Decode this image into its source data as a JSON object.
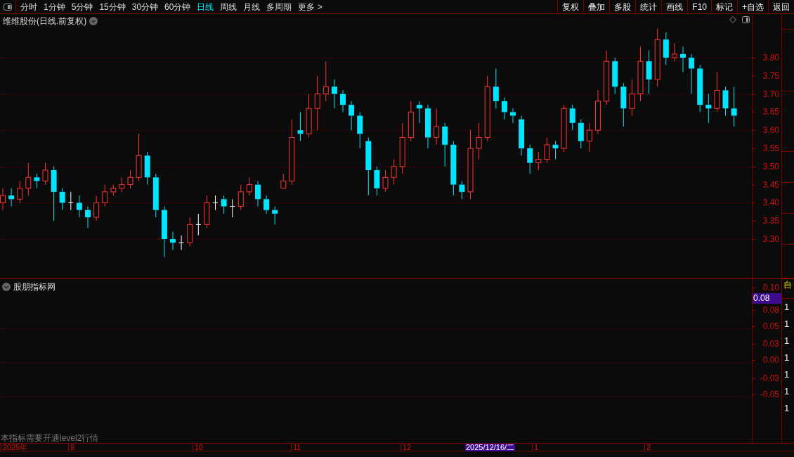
{
  "periods": [
    {
      "label": "分时",
      "selected": false
    },
    {
      "label": "1分钟",
      "selected": false
    },
    {
      "label": "5分钟",
      "selected": false
    },
    {
      "label": "15分钟",
      "selected": false
    },
    {
      "label": "30分钟",
      "selected": false
    },
    {
      "label": "60分钟",
      "selected": false
    },
    {
      "label": "日线",
      "selected": true
    },
    {
      "label": "周线",
      "selected": false
    },
    {
      "label": "月线",
      "selected": false
    },
    {
      "label": "多周期",
      "selected": false
    },
    {
      "label": "更多 >",
      "selected": false
    }
  ],
  "toolbar": [
    "复权",
    "叠加",
    "多股",
    "统计",
    "画线",
    "F10",
    "标记",
    "+自选",
    "返回"
  ],
  "main_panel": {
    "title": "维维股份(日线.前复权)",
    "axis_labels": [
      "3.80",
      "3.75",
      "3.70",
      "3.65",
      "3.60",
      "3.55",
      "3.50",
      "3.45",
      "3.40",
      "3.35",
      "3.30"
    ]
  },
  "indicator_panel": {
    "title": "股朋指标网",
    "current_value": "0.08",
    "axis_labels": [
      "0.10",
      "0.08",
      "0.05",
      "0.03",
      "0.00",
      "-0.03",
      "-0.05"
    ],
    "note": "本指标需要开通level2行情"
  },
  "side_strip": {
    "top": "自",
    "rows": [
      "1",
      "1",
      "1",
      "1",
      "1",
      "1",
      "1"
    ]
  },
  "date_axis": [
    {
      "label": "2025年",
      "selected": false
    },
    {
      "label": "9",
      "selected": false
    },
    {
      "label": "10",
      "selected": false
    },
    {
      "label": "11",
      "selected": false
    },
    {
      "label": "12",
      "selected": false
    },
    {
      "label": "2025/12/16/二",
      "selected": true
    },
    {
      "label": "1",
      "selected": false
    },
    {
      "label": "2",
      "selected": false
    }
  ]
}
